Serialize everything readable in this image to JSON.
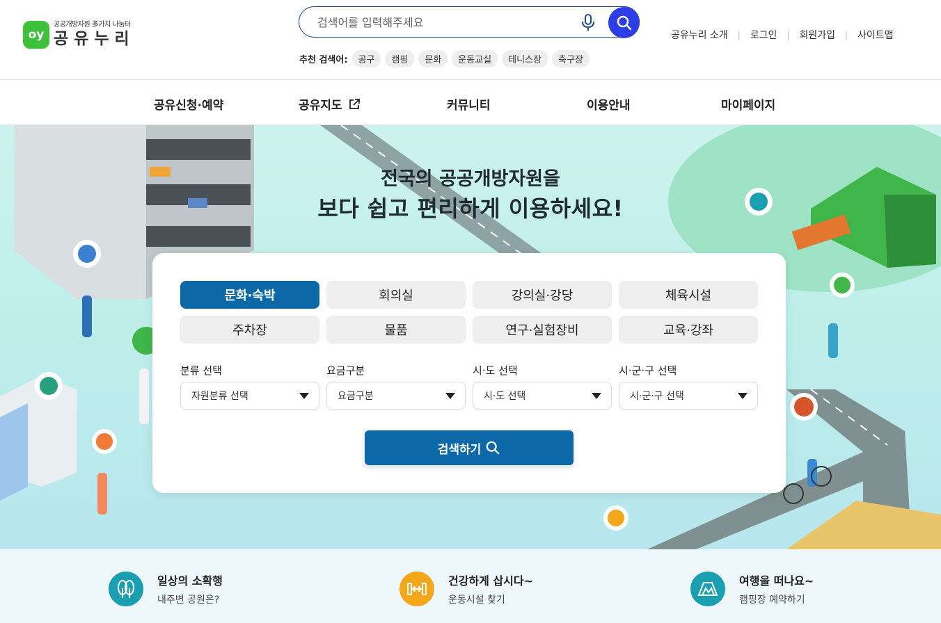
{
  "logo": {
    "mark": "oy",
    "subtitle": "공공개방자원 多가치 나눔터",
    "name": "공유누리"
  },
  "search": {
    "placeholder": "검색어를 입력해주세요"
  },
  "recommended": {
    "label": "추천 검색어:",
    "keywords": [
      "공구",
      "캠핑",
      "문화",
      "운동교실",
      "테니스장",
      "축구장"
    ]
  },
  "util_links": [
    "공유누리 소개",
    "로그인",
    "회원가입",
    "사이트맵"
  ],
  "gnb": [
    "공유신청·예약",
    "공유지도",
    "커뮤니티",
    "이용안내",
    "마이페이지"
  ],
  "hero": {
    "title_line1": "전국의 공공개방자원을",
    "title_line2": "보다 쉽고 편리하게 이용하세요!"
  },
  "categories": [
    "문화·숙박",
    "회의실",
    "강의실·강당",
    "체육시설",
    "주차장",
    "물품",
    "연구·실험장비",
    "교육·강좌"
  ],
  "active_category": "문화·숙박",
  "filters": [
    {
      "label": "분류 선택",
      "value": "자원분류 선택"
    },
    {
      "label": "요금구분",
      "value": "요금구분"
    },
    {
      "label": "시·도 선택",
      "value": "시·도 선택"
    },
    {
      "label": "시·군·구 선택",
      "value": "시·군·구 선택"
    }
  ],
  "search_button": "검색하기",
  "quick_links": [
    {
      "title": "일상의 소확행",
      "sub": "내주변 공원은?",
      "icon": "park-icon",
      "color": "#1a9fb1"
    },
    {
      "title": "건강하게 삽시다~",
      "sub": "운동시설 찾기",
      "icon": "dumbbell-icon",
      "color": "#f2a71b"
    },
    {
      "title": "여행을 떠나요~",
      "sub": "캠핑장 예약하기",
      "icon": "tent-icon",
      "color": "#1a9fb1"
    }
  ],
  "colors": {
    "primary": "#0d68a8",
    "search_button": "#2d3ee6",
    "logo_green": "#3ec13a"
  }
}
